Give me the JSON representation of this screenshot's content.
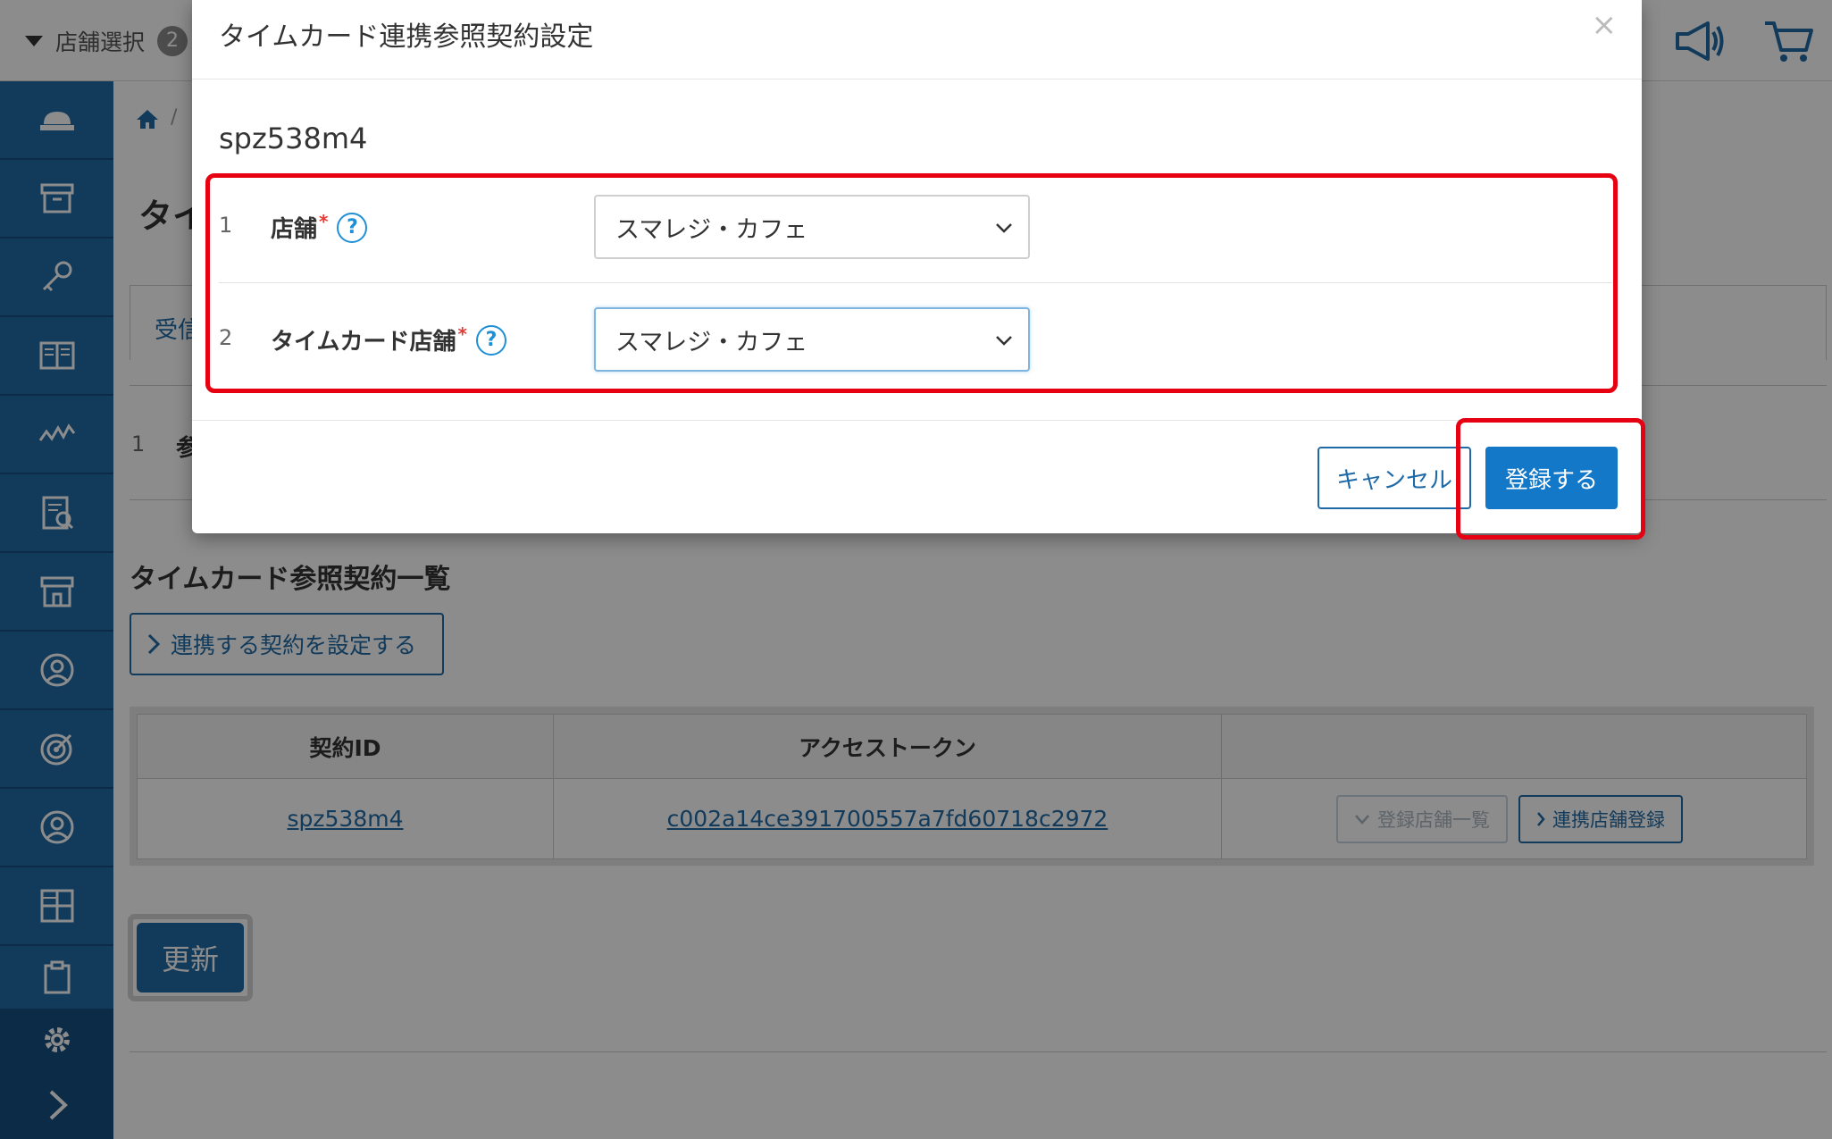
{
  "topbar": {
    "store_select_label": "店舗選択",
    "store_count": "2",
    "icons": [
      "megaphone-icon",
      "cart-icon"
    ]
  },
  "sidebar": {
    "icons": [
      "cloud-register-icon",
      "archive-box-icon",
      "key-icon",
      "book-icon",
      "analytics-icon",
      "report-icon",
      "store-icon",
      "customer-icon",
      "target-icon",
      "user-icon",
      "grid-icon",
      "clipboard-icon",
      "gear-icon",
      "chevron-right-icon"
    ],
    "background_color": "#1f6aa6"
  },
  "background_page": {
    "page_title_partial": "タイ",
    "tab_partial": "受信",
    "row1_num": "1",
    "row1_label_partial": "参",
    "section_title": "タイムカード参照契約一覧",
    "link_button_label": "連携する契約を設定する",
    "table": {
      "headers": [
        "契約ID",
        "アクセストークン",
        ""
      ],
      "rows": [
        {
          "contract_id": "spz538m4",
          "access_token": "c002a14ce391700557a7fd60718c2972",
          "btn_store_list": "登録店舗一覧",
          "btn_register_store": "連携店舗登録"
        }
      ]
    },
    "update_button_label": "更新"
  },
  "modal": {
    "title": "タイムカード連携参照契約設定",
    "close_symbol": "×",
    "contract_id": "spz538m4",
    "rows": [
      {
        "num": "1",
        "label": "店舗",
        "required_mark": "*",
        "help": "?",
        "value": "スマレジ・カフェ"
      },
      {
        "num": "2",
        "label": "タイムカード店舗",
        "required_mark": "*",
        "help": "?",
        "value": "スマレジ・カフェ"
      }
    ],
    "cancel_label": "キャンセル",
    "submit_label": "登録する"
  },
  "colors": {
    "accent": "#1f6aa6",
    "primary_button": "#1478c8",
    "highlight": "#e60012"
  }
}
